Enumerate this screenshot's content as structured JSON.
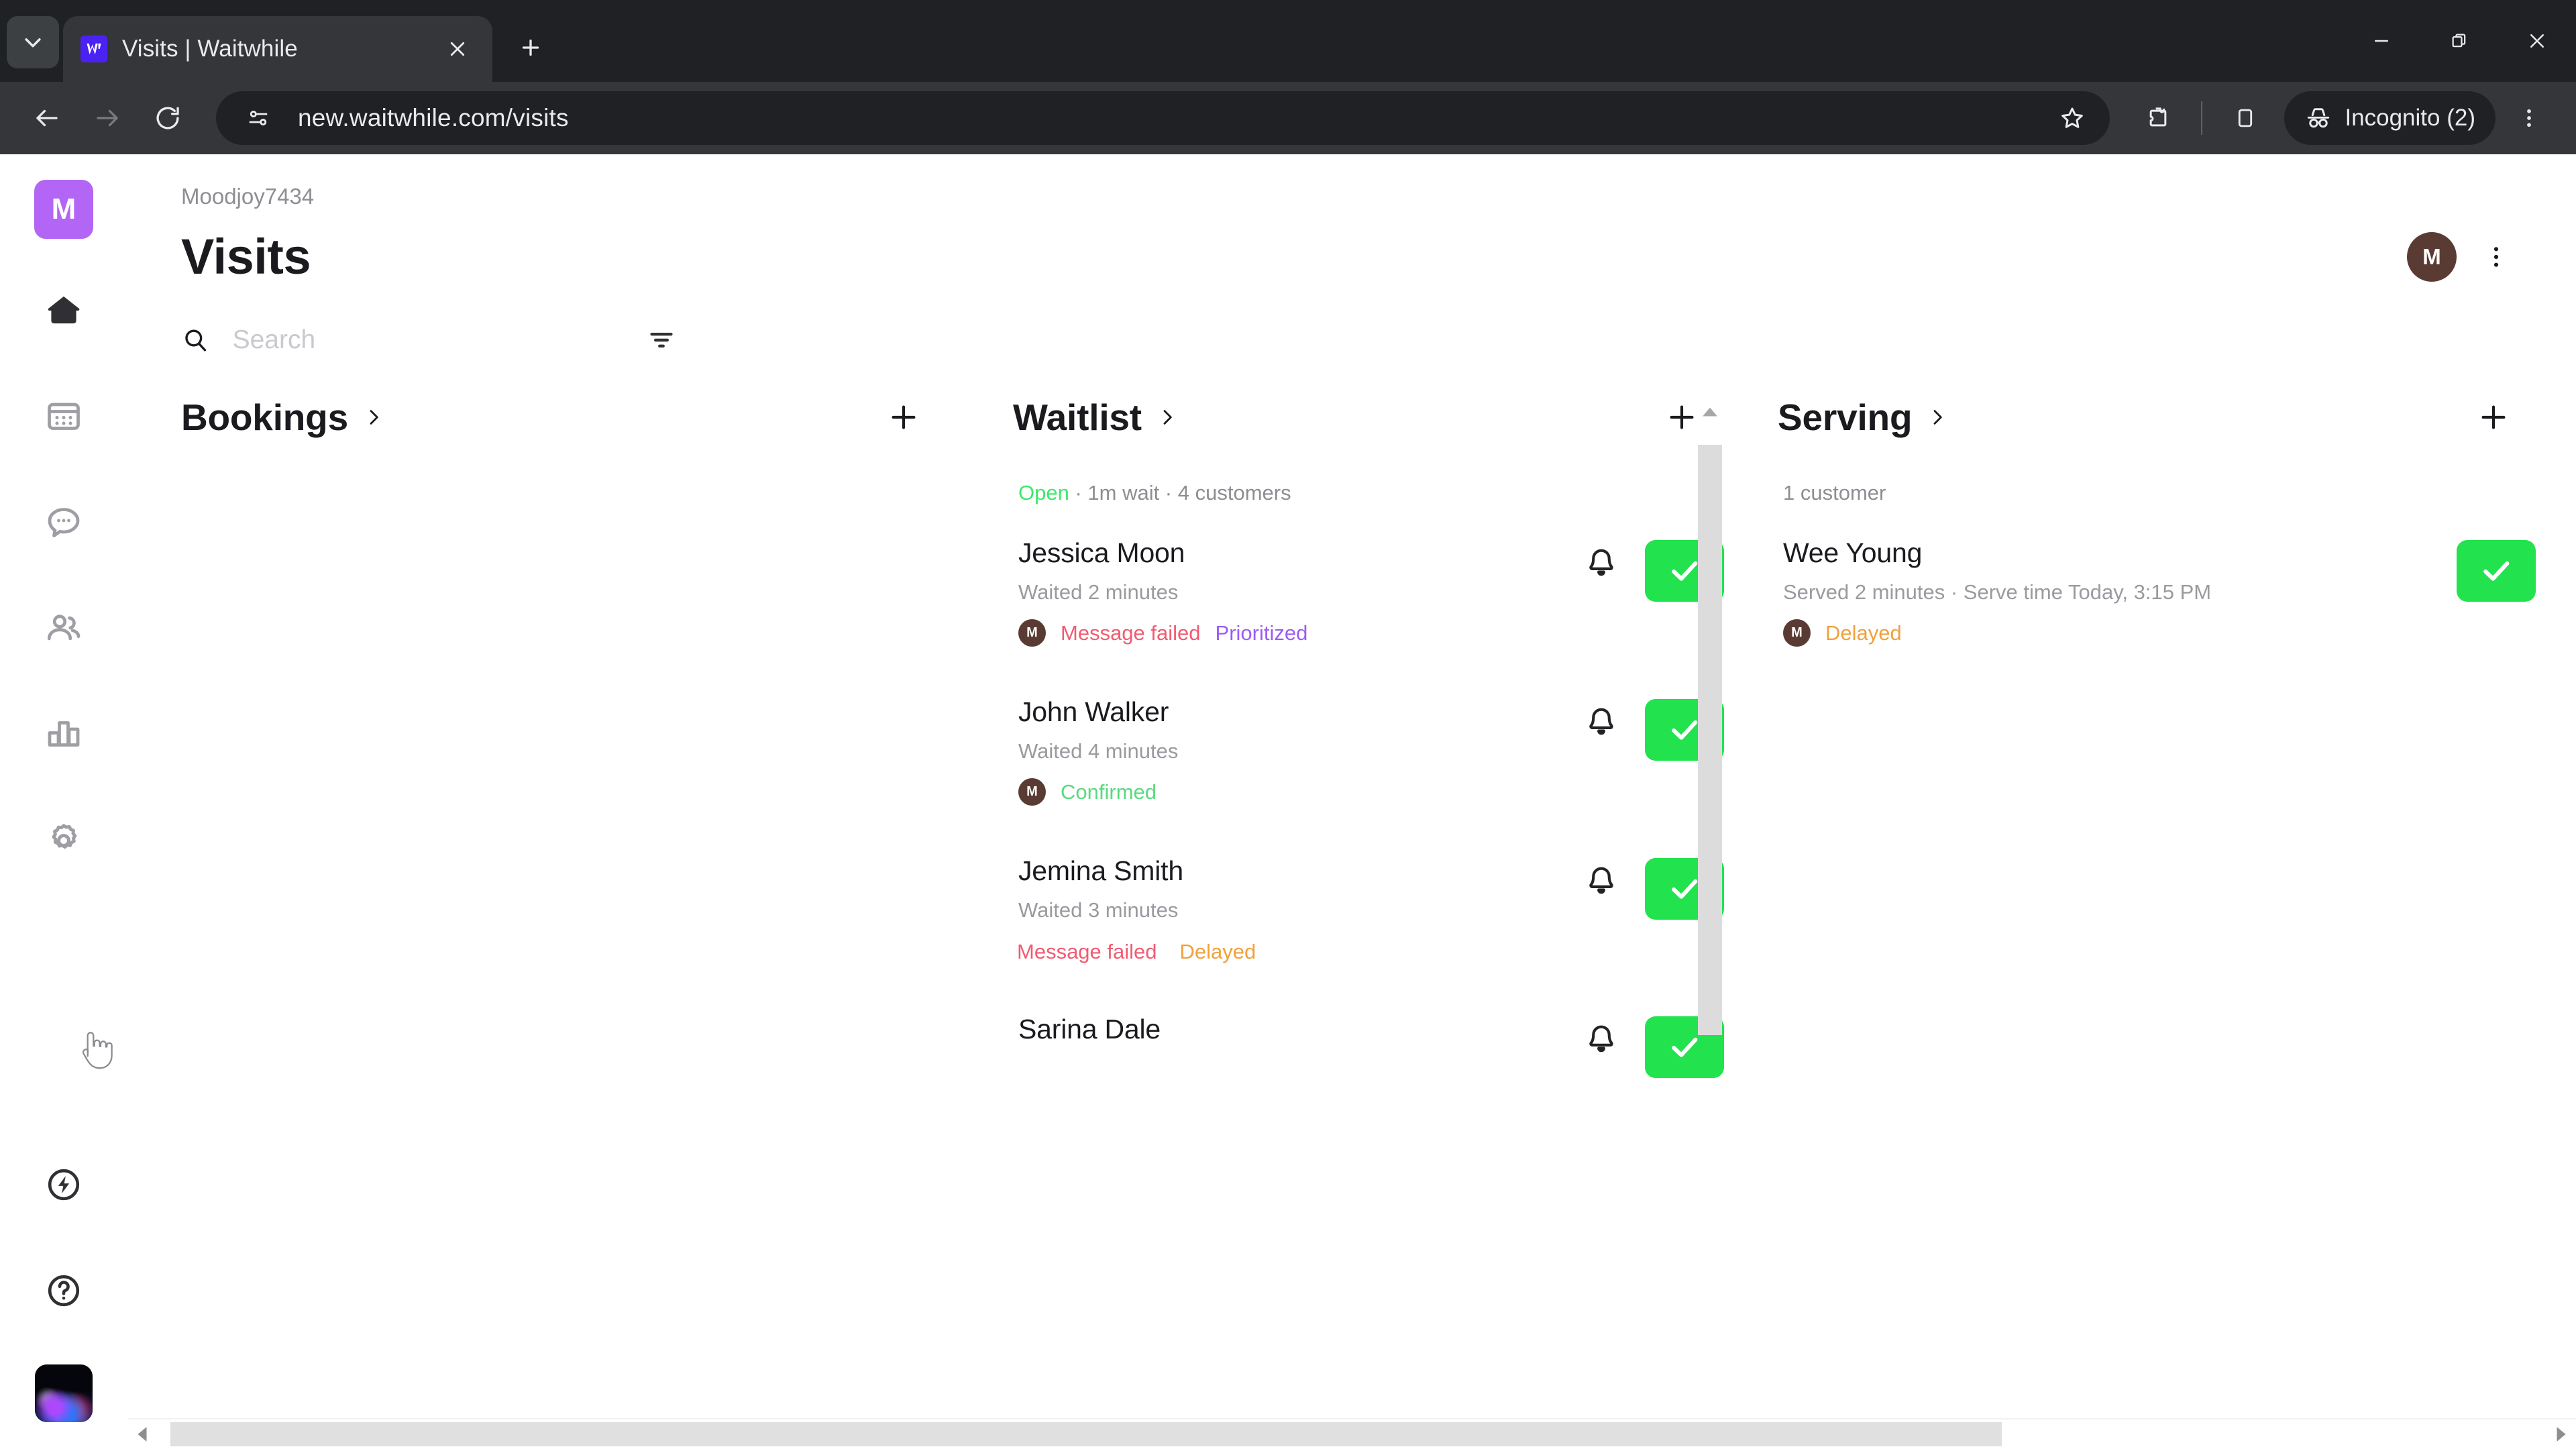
{
  "browser": {
    "tab": {
      "title": "Visits | Waitwhile",
      "favicon_icon": "waitwhile-logo-icon"
    },
    "tab_search_icon": "chevron-down-icon",
    "new_tab_icon": "plus-icon",
    "window_controls": {
      "minimize_icon": "minimize-icon",
      "maximize_icon": "restore-icon",
      "close_icon": "close-icon"
    },
    "toolbar": {
      "back_icon": "back-arrow-icon",
      "forward_icon": "forward-arrow-icon",
      "reload_icon": "reload-icon",
      "site_settings_icon": "tune-sliders-icon",
      "url": "new.waitwhile.com/visits",
      "bookmark_icon": "star-icon",
      "extensions_icon": "extensions-puzzle-icon",
      "side_panel_icon": "side-panel-icon",
      "profile_icon": "incognito-spy-icon",
      "profile_label": "Incognito (2)",
      "menu_icon": "three-dots-vertical-icon"
    }
  },
  "sidebar": {
    "logo": "M",
    "items": [
      {
        "name": "home",
        "icon": "home-icon",
        "active": true
      },
      {
        "name": "bookings",
        "icon": "calendar-icon",
        "active": false
      },
      {
        "name": "messages",
        "icon": "chat-bubble-icon",
        "active": false
      },
      {
        "name": "customers",
        "icon": "people-icon",
        "active": false
      },
      {
        "name": "analytics",
        "icon": "bar-chart-icon",
        "active": false
      },
      {
        "name": "settings",
        "icon": "gear-icon",
        "active": false
      }
    ],
    "bottom_items": [
      {
        "name": "whats-new",
        "icon": "lightning-bolt-circle-icon"
      },
      {
        "name": "help",
        "icon": "question-mark-circle-icon"
      }
    ],
    "avatar": "user-avatar-image"
  },
  "header": {
    "breadcrumb": "Moodjoy7434",
    "title": "Visits",
    "account_avatar_initial": "M",
    "overflow_icon": "three-dots-vertical-icon"
  },
  "search": {
    "icon": "search-icon",
    "value": "",
    "placeholder": "Search",
    "filter_icon": "filter-icon"
  },
  "columns": [
    {
      "key": "bookings",
      "title": "Bookings",
      "chevron_icon": "chevron-right-icon",
      "add_icon": "plus-icon",
      "meta": null,
      "meta_status": null,
      "entries": []
    },
    {
      "key": "waitlist",
      "title": "Waitlist",
      "chevron_icon": "chevron-right-icon",
      "add_icon": "plus-icon",
      "meta_status": "Open",
      "meta": " · 1m wait · 4 customers",
      "entries": [
        {
          "name": "Jessica Moon",
          "sub": "Waited 2 minutes",
          "avatar": "M",
          "show_avatar": true,
          "tags": [
            {
              "text": "Message failed",
              "style": "failed"
            },
            {
              "text": "Prioritized",
              "style": "prioritized"
            }
          ],
          "bell_icon": "bell-icon",
          "check_icon": "check-icon"
        },
        {
          "name": "John Walker",
          "sub": "Waited 4 minutes",
          "avatar": "M",
          "show_avatar": true,
          "tags": [
            {
              "text": "Confirmed",
              "style": "confirmed"
            }
          ],
          "bell_icon": "bell-icon",
          "check_icon": "check-icon"
        },
        {
          "name": "Jemina Smith",
          "sub": "Waited 3 minutes",
          "avatar": "",
          "show_avatar": false,
          "tags": [
            {
              "text": "Message failed",
              "style": "failed"
            },
            {
              "text": "Delayed",
              "style": "delayed"
            }
          ],
          "bell_icon": "bell-icon",
          "check_icon": "check-icon"
        },
        {
          "name": "Sarina Dale",
          "sub": "",
          "avatar": "",
          "show_avatar": false,
          "tags": [],
          "bell_icon": "bell-icon",
          "check_icon": "check-icon"
        }
      ],
      "scrollbar": {
        "up_arrow_icon": "scroll-up-arrow-icon",
        "down_arrow_icon": "scroll-down-arrow-icon"
      }
    },
    {
      "key": "serving",
      "title": "Serving",
      "chevron_icon": "chevron-right-icon",
      "add_icon": "plus-icon",
      "meta_status": null,
      "meta": "1 customer",
      "entries": [
        {
          "name": "Wee Young",
          "sub": "Served 2 minutes · Serve time Today, 3:15 PM",
          "avatar": "M",
          "show_avatar": true,
          "tags": [
            {
              "text": "Delayed",
              "style": "delayed"
            }
          ],
          "bell_icon": null,
          "check_icon": "check-icon"
        }
      ]
    }
  ],
  "hscrollbar": {
    "left_arrow_icon": "scroll-left-arrow-icon",
    "right_arrow_icon": "scroll-right-arrow-icon"
  },
  "colors": {
    "brand_purple": "#b366f5",
    "accent_green": "#22e24d",
    "status_open": "#3ce86a",
    "tag_failed": "#f15b72",
    "tag_prioritized": "#9b5cf6",
    "tag_confirmed": "#59d97f",
    "tag_delayed": "#f0a13c",
    "chrome_dark": "#202124",
    "toolbar_dark": "#35363a"
  }
}
